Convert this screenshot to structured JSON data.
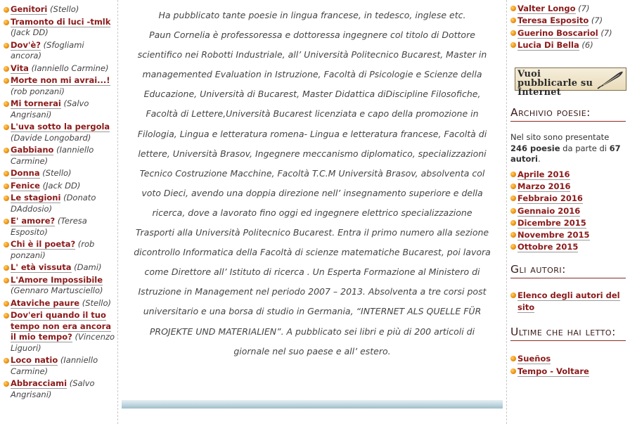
{
  "left_poems": [
    {
      "title": "Genitori",
      "author": "(Stello)"
    },
    {
      "title": "Tramonto di luci -tmlk",
      "author": "(Jack DD)"
    },
    {
      "title": "Dov'è?",
      "author": "(Sfogliami ancora)"
    },
    {
      "title": "Vita",
      "author": "(Ianniello Carmine)"
    },
    {
      "title": "Morte non mi avrai...!",
      "author": "(rob ponzani)"
    },
    {
      "title": "Mi tornerai",
      "author": "(Salvo Angrisani)"
    },
    {
      "title": "L'uva sotto la pergola",
      "author": "(Davide Longobard)"
    },
    {
      "title": "Gabbiano",
      "author": "(Ianniello Carmine)"
    },
    {
      "title": "Donna",
      "author": "(Stello)"
    },
    {
      "title": "Fenice",
      "author": "(Jack DD)"
    },
    {
      "title": "Le stagioni",
      "author": "(Donato DAddosio)"
    },
    {
      "title": "E' amore?",
      "author": "(Teresa Esposito)"
    },
    {
      "title": "Chi è il poeta?",
      "author": "(rob ponzani)"
    },
    {
      "title": "L' età vissuta",
      "author": "(Dami)"
    },
    {
      "title": "L'Amore Impossibile",
      "author": "(Gennaro Martusciello)"
    },
    {
      "title": "Ataviche paure",
      "author": "(Stello)"
    },
    {
      "title": "Dov'eri quando il tuo tempo non era ancora il mio tempo?",
      "author": "(Vincenzo Liguori)"
    },
    {
      "title": "Loco natio",
      "author": "(Ianniello Carmine)"
    },
    {
      "title": "Abbracciami",
      "author": "(Salvo Angrisani)"
    }
  ],
  "bio": {
    "paragraphs": [
      "Ha pubblicato tante poesie in lingua francese, in tedesco, inglese etc.",
      "Paun Cornelia è professoressa e dottoressa ingegnere col titolo di Dottore scientifico nei Robotti Industriale, all’ Università Politecnico Bucarest, Master in managemented Evaluation in Istruzione, Facoltà di Psicologie e Scienze della Educazione, Università di Bucarest, Master Didattica diDiscipline Filosofiche, Facoltà di Lettere,Università Bucarest licenziata e capo della promozione in Filologia, Lingua e letteratura romena- Lingua e letteratura francese, Facoltà di lettere, Università Brasov, Ingegnere meccanismo diplomatico, specializzazioni Tecnico Costruzione Macchine, Facoltà T.C.M Università Brasov, absolventa col voto Dieci, avendo una doppia direzione nell’ insegnamento superiore e della ricerca, dove a lavorato fino oggi ed ingegnere elettrico specializzazione Trasporti alla Università Politecnico Bucarest. Entra il primo numero alla sezione dicontrollo Informatica della Facoltà di scienze matematiche Bucarest, poi lavora come Direttore all’ Istituto di ricerca . Un Esperta Formazione al Ministero di Istruzione in Management nel periodo 2007 – 2013. Absolventa a tre corsi post universitario e una borsa di studio in Germania, “INTERNET ALS QUELLE FÜR PROJEKTE UND MATERIALIEN”. A pubblicato sei libri e più di 200 articoli di giornale nel suo paese e all’ estero."
    ]
  },
  "right": {
    "top_authors": [
      {
        "name": "Valter Longo",
        "count": "(7)"
      },
      {
        "name": "Teresa Esposito",
        "count": "(7)"
      },
      {
        "name": "Guerino Boscariol",
        "count": "(7)"
      },
      {
        "name": "Lucia Di Bella",
        "count": "(6)"
      }
    ],
    "banner_text": "Vuoi pubblicarle su Internet",
    "archive": {
      "heading": "Archivio poesie:",
      "text_before": "Nel sito sono presentate ",
      "poems_count": "246 poesie",
      "text_middle": " da parte di ",
      "authors_count": "67 autori",
      "text_after": ".",
      "months": [
        "Aprile 2016",
        "Marzo 2016",
        "Febbraio 2016",
        "Gennaio 2016",
        "Dicembre 2015",
        "Novembre 2015",
        "Ottobre 2015"
      ]
    },
    "authors": {
      "heading": "Gli autori:",
      "link": "Elenco degli autori del sito"
    },
    "recent": {
      "heading": "Ultime che hai letto:",
      "items": [
        "Sueños",
        "Tempo - Voltare"
      ]
    }
  }
}
